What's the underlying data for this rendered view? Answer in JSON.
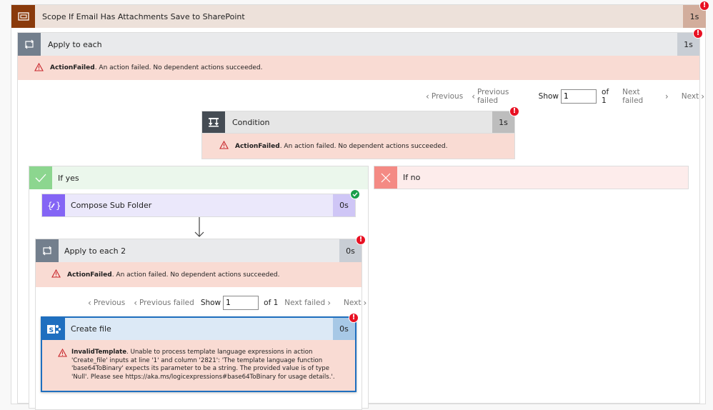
{
  "scope": {
    "title": "Scope If Email Has Attachments Save to SharePoint",
    "duration": "1s",
    "status": "error",
    "icon": "scope-icon",
    "colors": {
      "icon_bg": "#8a3a0b",
      "header_bg": "#ede1da",
      "duration_bg": "#d2ad9c"
    }
  },
  "apply_each": {
    "title": "Apply to each",
    "duration": "1s",
    "status": "error",
    "icon": "loop-icon",
    "error": {
      "code": "ActionFailed",
      "message": ". An action failed. No dependent actions succeeded."
    },
    "pager": {
      "previous": "Previous",
      "previous_failed": "Previous failed",
      "show": "Show",
      "current": "1",
      "of": "of 1",
      "next_failed": "Next failed",
      "next": "Next"
    }
  },
  "condition": {
    "title": "Condition",
    "duration": "1s",
    "status": "error",
    "icon": "condition-icon",
    "error": {
      "code": "ActionFailed",
      "message": ". An action failed. No dependent actions succeeded."
    }
  },
  "if_yes": {
    "label": "If yes",
    "icon": "check-icon",
    "color": "#8cd68f"
  },
  "if_no": {
    "label": "If no",
    "icon": "x-icon",
    "color": "#f48a84"
  },
  "compose": {
    "title": "Compose Sub Folder",
    "duration": "0s",
    "status": "success",
    "icon": "compose-icon",
    "colors": {
      "icon_bg": "#8465f5",
      "header_bg": "#ebe8fb",
      "duration_bg": "#cfc6f6"
    }
  },
  "apply_each_2": {
    "title": "Apply to each 2",
    "duration": "0s",
    "status": "error",
    "icon": "loop-icon",
    "error": {
      "code": "ActionFailed",
      "message": ". An action failed. No dependent actions succeeded."
    },
    "pager": {
      "previous": "Previous",
      "previous_failed": "Previous failed",
      "show": "Show",
      "current": "1",
      "of": "of 1",
      "next_failed": "Next failed",
      "next": "Next"
    }
  },
  "create_file": {
    "title": "Create file",
    "duration": "0s",
    "status": "error",
    "icon": "sharepoint-icon",
    "error": {
      "code": "InvalidTemplate",
      "message": ". Unable to process template language expressions in action 'Create_file' inputs at line '1' and column '2821': 'The template language function 'base64ToBinary' expects its parameter to be a string. The provided value is of type 'Null'. Please see https://aka.ms/logicexpressions#base64ToBinary for usage details.'."
    }
  },
  "status_badges": {
    "error": "!"
  }
}
